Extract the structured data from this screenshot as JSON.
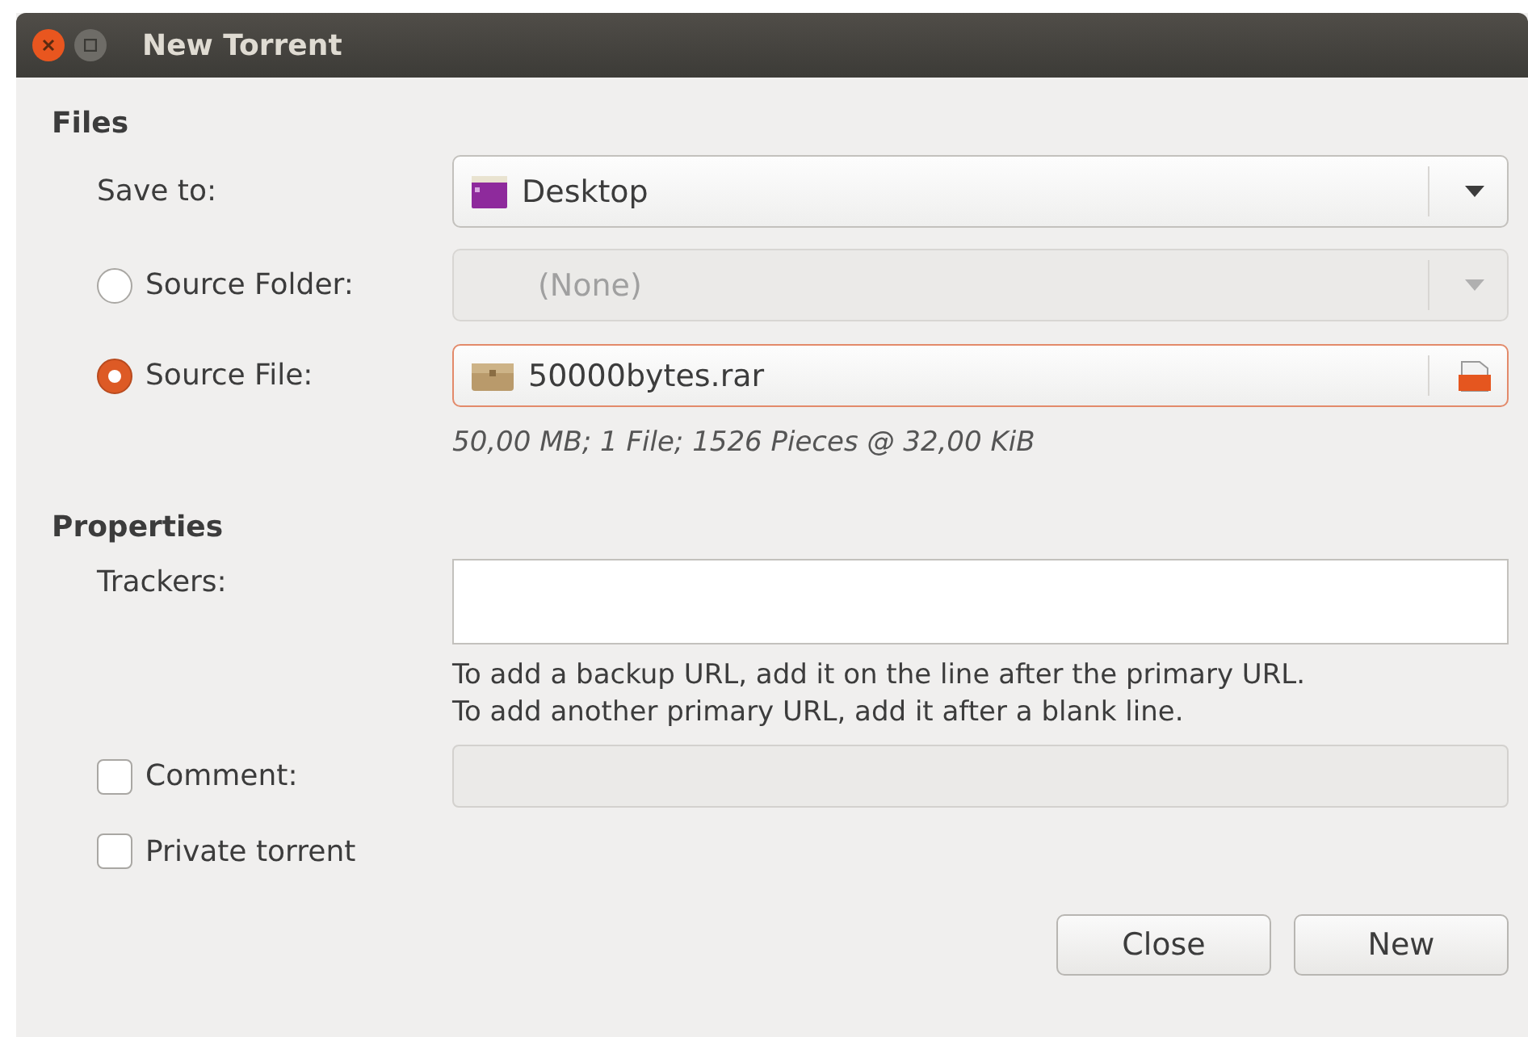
{
  "window": {
    "title": "New Torrent"
  },
  "files": {
    "heading": "Files",
    "save_to": {
      "label": "Save to:",
      "value": "Desktop",
      "disabled": false
    },
    "sources": [
      {
        "label": "Source Folder:",
        "selected": false,
        "value": "(None)",
        "disabled": true,
        "kind": "folder-combo"
      },
      {
        "label": "Source File:",
        "selected": true,
        "value": "50000bytes.rar",
        "disabled": false,
        "kind": "file-chooser"
      }
    ],
    "info": "50,00 MB; 1 File; 1526 Pieces @ 32,00 KiB"
  },
  "properties": {
    "heading": "Properties",
    "trackers": {
      "label": "Trackers:"
    },
    "hint": [
      "To add a backup URL, add it on the line after the primary URL.",
      "To add another primary URL, add it after a blank line."
    ],
    "comment": {
      "label": "Comment:",
      "checked": false
    },
    "private": {
      "label": "Private torrent",
      "checked": false
    }
  },
  "buttons": [
    "Close",
    "New"
  ]
}
